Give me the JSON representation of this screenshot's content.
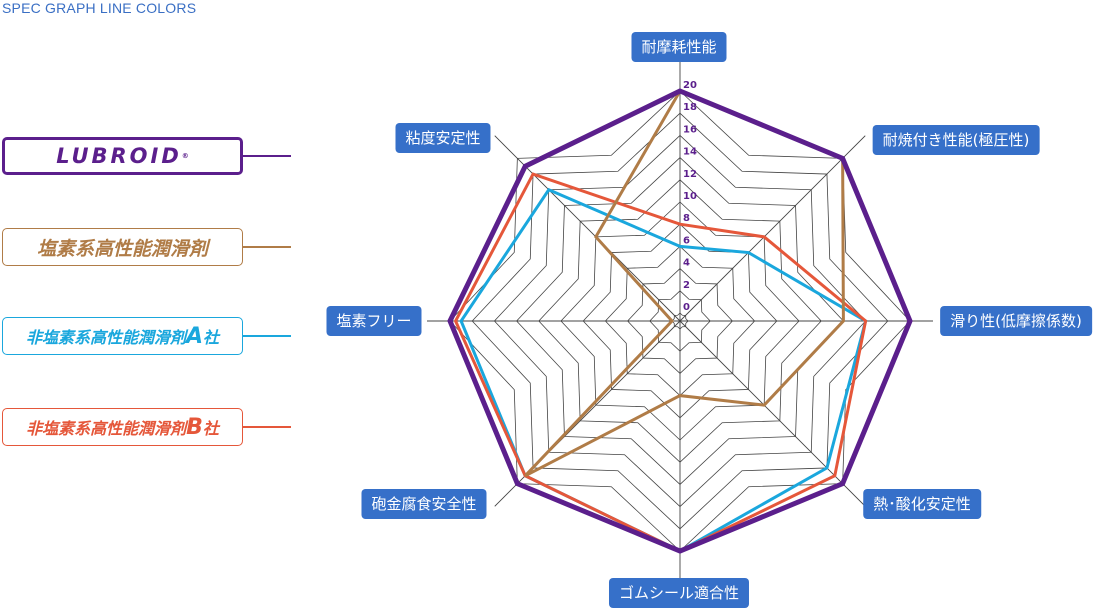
{
  "title": "SPEC GRAPH LINE COLORS",
  "legend": [
    {
      "label": "LUBROID",
      "registered_mark": "®",
      "color": "#5b1f8c"
    },
    {
      "label": "塩素系高性能潤滑剤",
      "color": "#b07c47"
    },
    {
      "label": "非塩素系高性能潤滑剤",
      "suffix_letter": "A",
      "suffix": "社",
      "color": "#1aa7dd"
    },
    {
      "label": "非塩素系高性能潤滑剤",
      "suffix_letter": "B",
      "suffix": "社",
      "color": "#e5573a"
    }
  ],
  "chart_data": {
    "type": "radar",
    "title": "SPEC GRAPH LINE COLORS",
    "axes": [
      "耐摩耗性能",
      "耐焼付き性能(極圧性)",
      "滑り性(低摩擦係数)",
      "熱･酸化安定性",
      "ゴムシール適合性",
      "砲金腐食安全性",
      "塩素フリー",
      "粘度安定性"
    ],
    "range": [
      0,
      20
    ],
    "ticks": [
      "0",
      "2",
      "4",
      "6",
      "8",
      "10",
      "12",
      "14",
      "16",
      "18",
      "20"
    ],
    "tick_values": [
      0,
      2,
      4,
      6,
      8,
      10,
      12,
      14,
      16,
      18,
      20
    ],
    "grid": true,
    "legend_position": "left",
    "series": [
      {
        "name": "非塩素系高性能潤滑剤A社",
        "color": "#1aa7dd",
        "values": [
          6,
          8,
          16,
          18,
          20,
          19,
          19,
          16
        ]
      },
      {
        "name": "非塩素系高性能潤滑剤B社",
        "color": "#e5573a",
        "values": [
          8,
          10,
          16,
          19,
          20,
          19,
          19.5,
          18
        ]
      },
      {
        "name": "塩素系高性能潤滑剤",
        "color": "#b07c47",
        "values": [
          20,
          20,
          14,
          10,
          6,
          19,
          0,
          10
        ]
      },
      {
        "name": "LUBROID",
        "color": "#5b1f8c",
        "values": [
          20,
          20,
          20,
          20,
          20,
          20,
          20,
          19
        ]
      }
    ]
  }
}
